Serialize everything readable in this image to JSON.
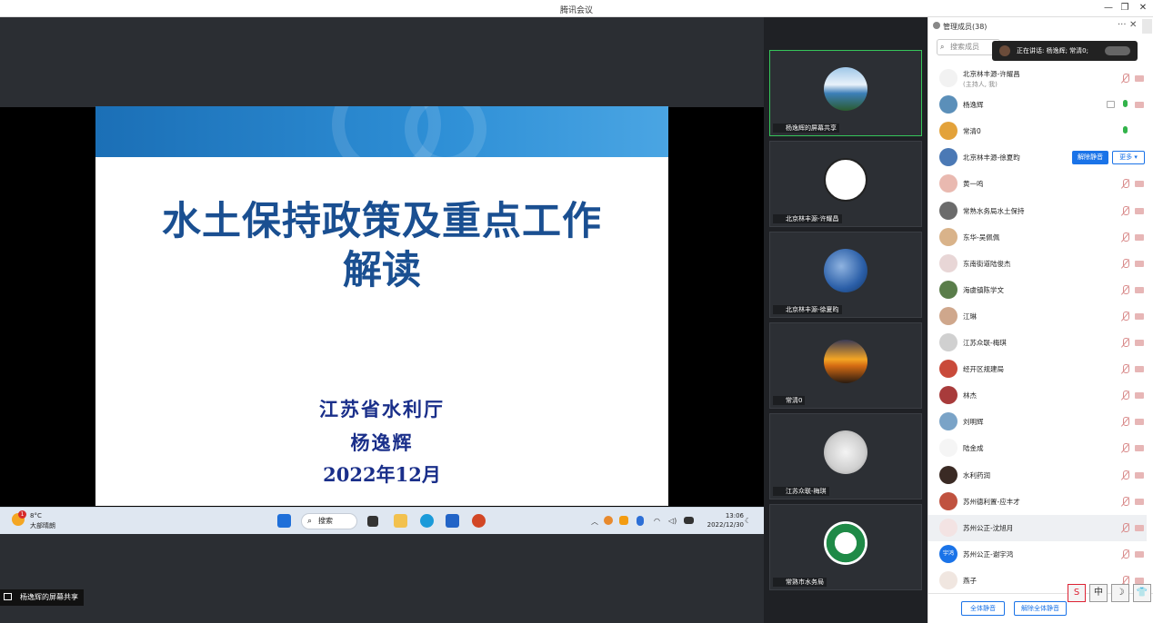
{
  "window": {
    "title": "腾讯会议",
    "min": "—",
    "restore": "❐",
    "close": "✕"
  },
  "slide": {
    "title_line1": "水土保持政策及重点工作",
    "title_line2": "解读",
    "org": "江苏省水利厅",
    "author": "杨逸辉",
    "date": "2022年12月"
  },
  "taskbar": {
    "temp": "8°C",
    "condition": "大部晴朗",
    "weather_badge": "1",
    "search": "搜索",
    "time": "13:06",
    "date": "2022/12/30"
  },
  "share_label": "杨逸辉的屏幕共享",
  "videos": [
    {
      "name": "杨逸辉的屏幕共享",
      "active": true,
      "avatar": "lake"
    },
    {
      "name": "北京林丰源-许耀昌",
      "avatar": "sketch"
    },
    {
      "name": "北京林丰源-徐夏昀",
      "avatar": "trees"
    },
    {
      "name": "常清0",
      "avatar": "sunset"
    },
    {
      "name": "江苏众联-梅琪",
      "avatar": "shoe"
    },
    {
      "name": "常熟市水务局",
      "avatar": "logo"
    }
  ],
  "panel": {
    "title": "管理成员(38)",
    "more": "···",
    "close": "✕",
    "search_placeholder": "搜索成员",
    "speaking": "正在讲话: 杨逸辉; 常清0;",
    "unmute_label": "解除静音",
    "more_label": "更多 ▾",
    "mute_all": "全体静音",
    "unmute_all": "解除全体静音",
    "members": [
      {
        "name": "北京林丰源-许耀昌",
        "sub": "(主持人, 我)",
        "av": "#f2f2f2",
        "state": "off"
      },
      {
        "name": "杨逸辉",
        "av": "#5b8fb9",
        "state": "on-screen"
      },
      {
        "name": "常清0",
        "av": "#e3a23a",
        "state": "on"
      },
      {
        "name": "北京林丰源-徐夏昀",
        "av": "#4b79b5",
        "state": "host"
      },
      {
        "name": "黄一鸣",
        "av": "#e9b9b0",
        "state": "off"
      },
      {
        "name": "常熟水务局水土保持",
        "av": "#6b6b6b",
        "state": "off"
      },
      {
        "name": "东华-吴佩佩",
        "av": "#d9b38a",
        "state": "off"
      },
      {
        "name": "东南街道陆俊杰",
        "av": "#e8d6d6",
        "state": "off"
      },
      {
        "name": "海虞镇陈学文",
        "av": "#5a7d4a",
        "state": "off"
      },
      {
        "name": "江琳",
        "av": "#cfa78c",
        "state": "off"
      },
      {
        "name": "江苏众联-梅琪",
        "av": "#d0d0d0",
        "state": "off"
      },
      {
        "name": "经开区规建局",
        "av": "#c94a3a",
        "state": "off"
      },
      {
        "name": "林杰",
        "av": "#a83b3b",
        "state": "off"
      },
      {
        "name": "刘明辉",
        "av": "#7aa3c7",
        "state": "off"
      },
      {
        "name": "陆金成",
        "av": "#f5f5f5",
        "state": "off"
      },
      {
        "name": "水利药润",
        "av": "#3a2a24",
        "state": "off"
      },
      {
        "name": "苏州德利置-应丰才",
        "av": "#c0523f",
        "state": "off"
      },
      {
        "name": "苏州公正-沈旭月",
        "av": "#f3e3e3",
        "state": "off",
        "selected": true
      },
      {
        "name": "苏州公正-谢宇鸿",
        "av": "#1a73e8",
        "state": "off",
        "avtext": "宇鸿"
      },
      {
        "name": "燕子",
        "av": "#f0e6e0",
        "state": "off"
      }
    ]
  },
  "ime": [
    "S",
    "中",
    "☽",
    "👕"
  ]
}
